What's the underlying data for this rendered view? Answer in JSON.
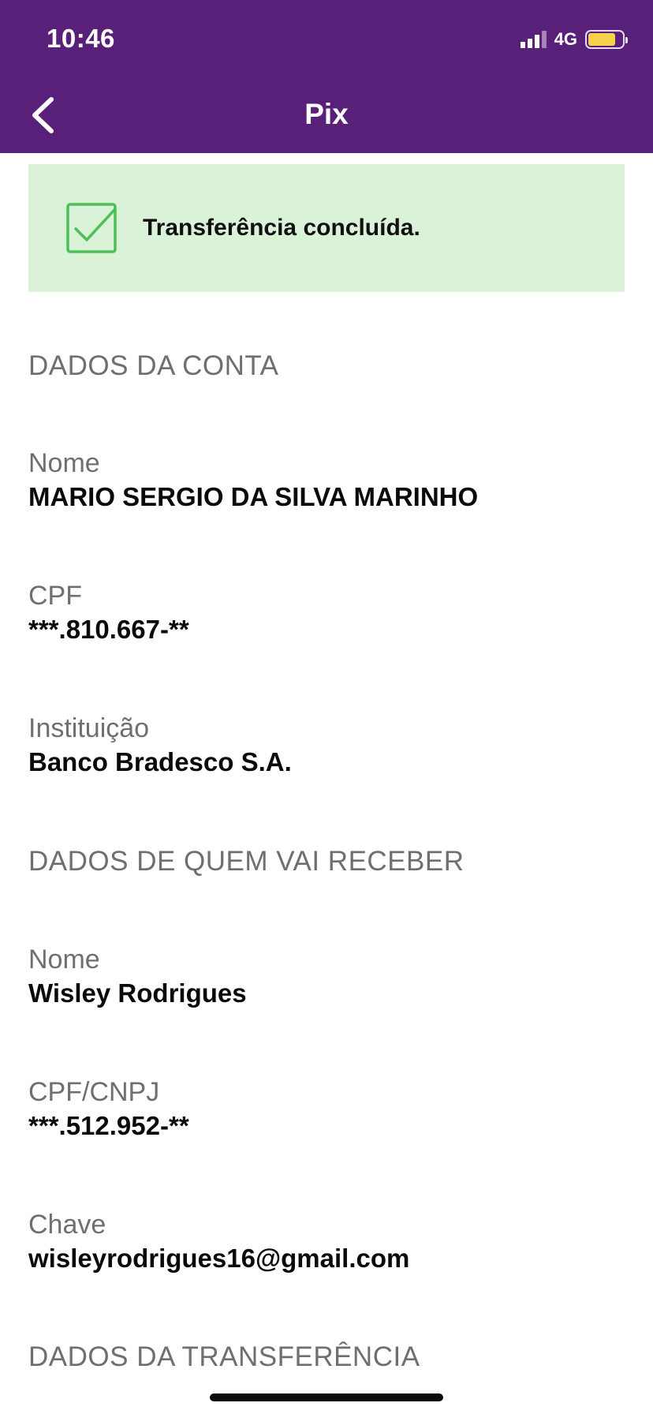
{
  "status_bar": {
    "time": "10:46",
    "network": "4G",
    "signal_icon": "signal-bars-icon",
    "battery_icon": "battery-icon",
    "battery_color": "#f6d24a"
  },
  "header": {
    "title": "Pix",
    "back_icon": "chevron-left-icon",
    "background": "#59207a"
  },
  "banner": {
    "icon": "check-square-icon",
    "message": "Transferência concluída.",
    "background": "#daf2d8",
    "accent": "#4cbf56"
  },
  "account": {
    "section_title": "DADOS DA CONTA",
    "name_label": "Nome",
    "name_value": "MARIO SERGIO DA SILVA MARINHO",
    "cpf_label": "CPF",
    "cpf_value": "***.810.667-**",
    "institution_label": "Instituição",
    "institution_value": "Banco Bradesco S.A."
  },
  "recipient": {
    "section_title": "DADOS DE QUEM VAI RECEBER",
    "name_label": "Nome",
    "name_value": "Wisley Rodrigues",
    "doc_label": "CPF/CNPJ",
    "doc_value": "***.512.952-**",
    "key_label": "Chave",
    "key_value": "wisleyrodrigues16@gmail.com"
  },
  "transfer": {
    "section_title": "DADOS DA TRANSFERÊNCIA"
  }
}
